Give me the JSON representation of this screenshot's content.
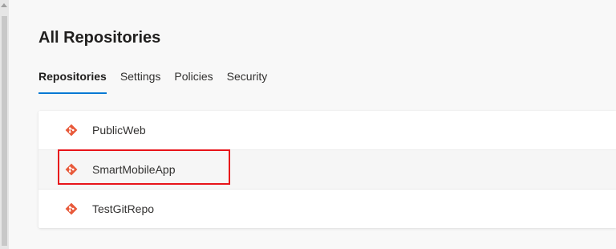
{
  "page": {
    "title": "All Repositories"
  },
  "tabs": [
    {
      "label": "Repositories",
      "active": true
    },
    {
      "label": "Settings",
      "active": false
    },
    {
      "label": "Policies",
      "active": false
    },
    {
      "label": "Security",
      "active": false
    }
  ],
  "repositories": [
    {
      "name": "PublicWeb",
      "icon": "git-repo-icon"
    },
    {
      "name": "SmartMobileApp",
      "icon": "git-repo-icon",
      "highlighted": true
    },
    {
      "name": "TestGitRepo",
      "icon": "git-repo-icon"
    }
  ],
  "colors": {
    "accent": "#0078d4",
    "git_icon": "#e8593a",
    "highlight": "#e8141a"
  }
}
